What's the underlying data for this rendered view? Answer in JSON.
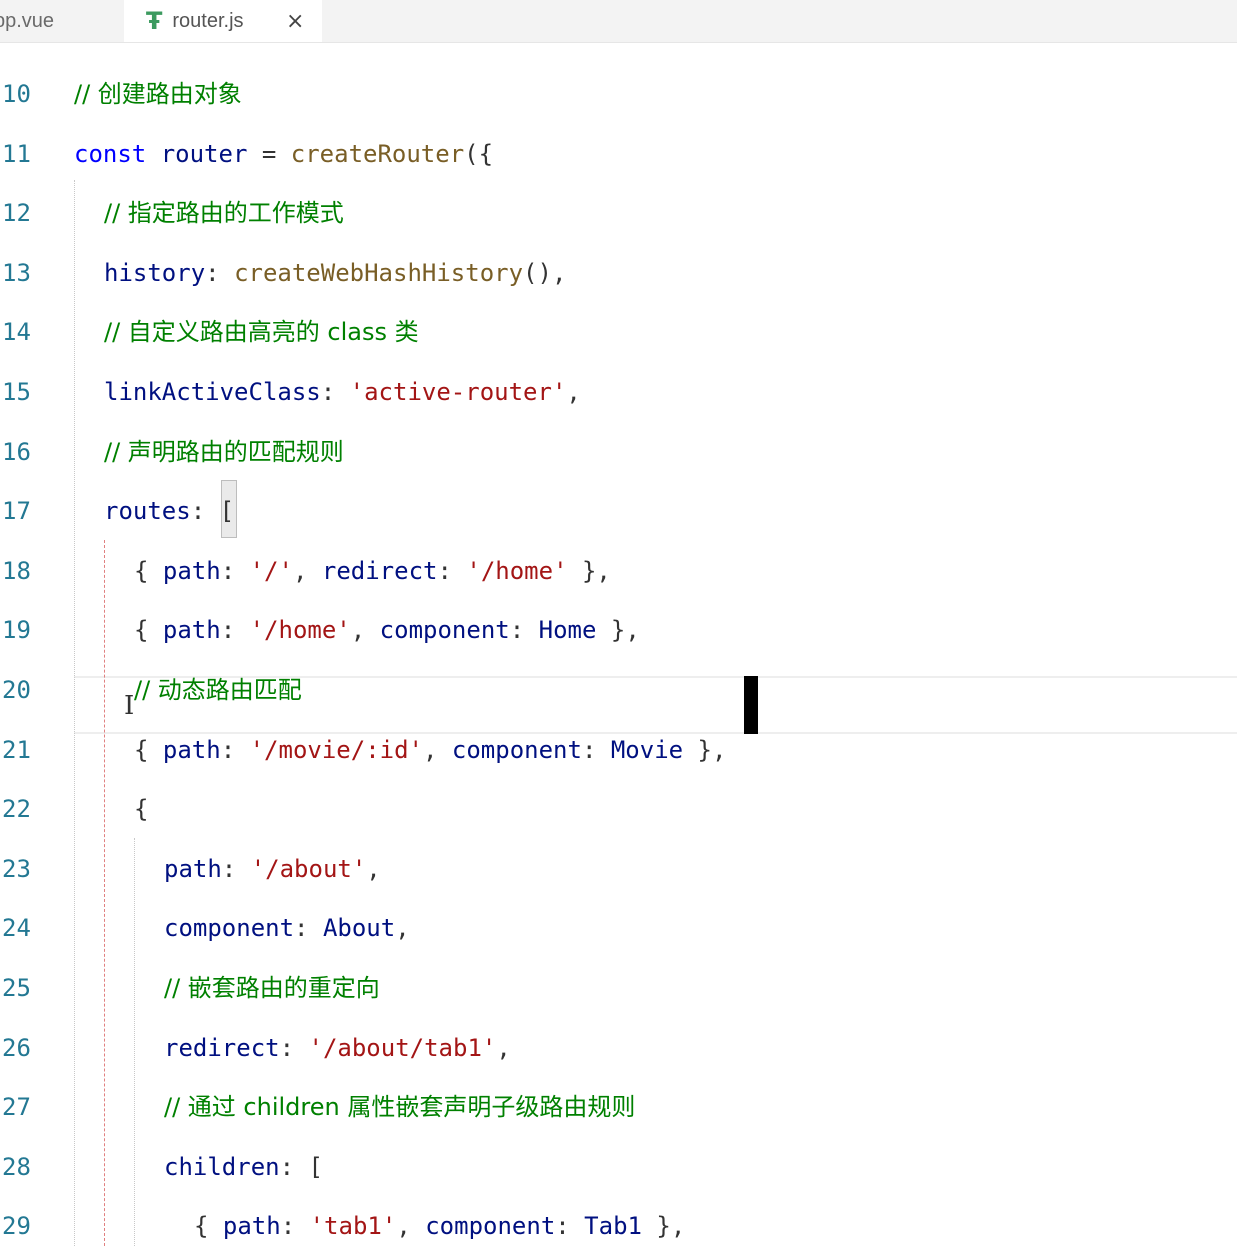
{
  "tabs": [
    {
      "label": "pp.vue",
      "active": false
    },
    {
      "label": "router.js",
      "active": true,
      "icon": "js-file-icon",
      "close": "×"
    }
  ],
  "lines": [
    {
      "n": "10",
      "indent": 0,
      "tokens": [
        [
          "c",
          "// 创建路由对象"
        ]
      ]
    },
    {
      "n": "11",
      "indent": 0,
      "tokens": [
        [
          "k",
          "const"
        ],
        [
          "p",
          " "
        ],
        [
          "v",
          "router"
        ],
        [
          "p",
          " = "
        ],
        [
          "f",
          "createRouter"
        ],
        [
          "p",
          "({"
        ]
      ]
    },
    {
      "n": "12",
      "indent": 1,
      "tokens": [
        [
          "c",
          "// 指定路由的工作模式"
        ]
      ]
    },
    {
      "n": "13",
      "indent": 1,
      "tokens": [
        [
          "v",
          "history"
        ],
        [
          "p",
          ": "
        ],
        [
          "f",
          "createWebHashHistory"
        ],
        [
          "p",
          "(),"
        ]
      ]
    },
    {
      "n": "14",
      "indent": 1,
      "tokens": [
        [
          "c",
          "// 自定义路由高亮的 class 类"
        ]
      ]
    },
    {
      "n": "15",
      "indent": 1,
      "tokens": [
        [
          "v",
          "linkActiveClass"
        ],
        [
          "p",
          ": "
        ],
        [
          "s",
          "'active-router'"
        ],
        [
          "p",
          ","
        ]
      ]
    },
    {
      "n": "16",
      "indent": 1,
      "tokens": [
        [
          "c",
          "// 声明路由的匹配规则"
        ]
      ]
    },
    {
      "n": "17",
      "indent": 1,
      "tokens": [
        [
          "v",
          "routes"
        ],
        [
          "p",
          ": ["
        ]
      ]
    },
    {
      "n": "18",
      "indent": 2,
      "tokens": [
        [
          "p",
          "{ "
        ],
        [
          "v",
          "path"
        ],
        [
          "p",
          ": "
        ],
        [
          "s",
          "'/'"
        ],
        [
          "p",
          ", "
        ],
        [
          "v",
          "redirect"
        ],
        [
          "p",
          ": "
        ],
        [
          "s",
          "'/home'"
        ],
        [
          "p",
          " },"
        ]
      ]
    },
    {
      "n": "19",
      "indent": 2,
      "tokens": [
        [
          "p",
          "{ "
        ],
        [
          "v",
          "path"
        ],
        [
          "p",
          ": "
        ],
        [
          "s",
          "'/home'"
        ],
        [
          "p",
          ", "
        ],
        [
          "v",
          "component"
        ],
        [
          "p",
          ": "
        ],
        [
          "v",
          "Home"
        ],
        [
          "p",
          " },"
        ]
      ]
    },
    {
      "n": "20",
      "indent": 2,
      "tokens": [
        [
          "c",
          "// 动态路由匹配"
        ]
      ]
    },
    {
      "n": "21",
      "indent": 2,
      "tokens": [
        [
          "p",
          "{ "
        ],
        [
          "v",
          "path"
        ],
        [
          "p",
          ": "
        ],
        [
          "s",
          "'/movie/:id'"
        ],
        [
          "p",
          ", "
        ],
        [
          "v",
          "component"
        ],
        [
          "p",
          ": "
        ],
        [
          "v",
          "Movie"
        ],
        [
          "p",
          " },"
        ]
      ]
    },
    {
      "n": "22",
      "indent": 2,
      "tokens": [
        [
          "p",
          "{"
        ]
      ]
    },
    {
      "n": "23",
      "indent": 3,
      "tokens": [
        [
          "v",
          "path"
        ],
        [
          "p",
          ": "
        ],
        [
          "s",
          "'/about'"
        ],
        [
          "p",
          ","
        ]
      ]
    },
    {
      "n": "24",
      "indent": 3,
      "tokens": [
        [
          "v",
          "component"
        ],
        [
          "p",
          ": "
        ],
        [
          "v",
          "About"
        ],
        [
          "p",
          ","
        ]
      ]
    },
    {
      "n": "25",
      "indent": 3,
      "tokens": [
        [
          "c",
          "// 嵌套路由的重定向"
        ]
      ]
    },
    {
      "n": "26",
      "indent": 3,
      "tokens": [
        [
          "v",
          "redirect"
        ],
        [
          "p",
          ": "
        ],
        [
          "s",
          "'/about/tab1'"
        ],
        [
          "p",
          ","
        ]
      ]
    },
    {
      "n": "27",
      "indent": 3,
      "tokens": [
        [
          "c",
          "// 通过 children 属性嵌套声明子级路由规则"
        ]
      ]
    },
    {
      "n": "28",
      "indent": 3,
      "tokens": [
        [
          "v",
          "children"
        ],
        [
          "p",
          ": ["
        ]
      ]
    },
    {
      "n": "29",
      "indent": 4,
      "tokens": [
        [
          "p",
          "{ "
        ],
        [
          "v",
          "path"
        ],
        [
          "p",
          ": "
        ],
        [
          "s",
          "'tab1'"
        ],
        [
          "p",
          ", "
        ],
        [
          "v",
          "component"
        ],
        [
          "p",
          ": "
        ],
        [
          "v",
          "Tab1"
        ],
        [
          "p",
          " },"
        ]
      ]
    }
  ]
}
